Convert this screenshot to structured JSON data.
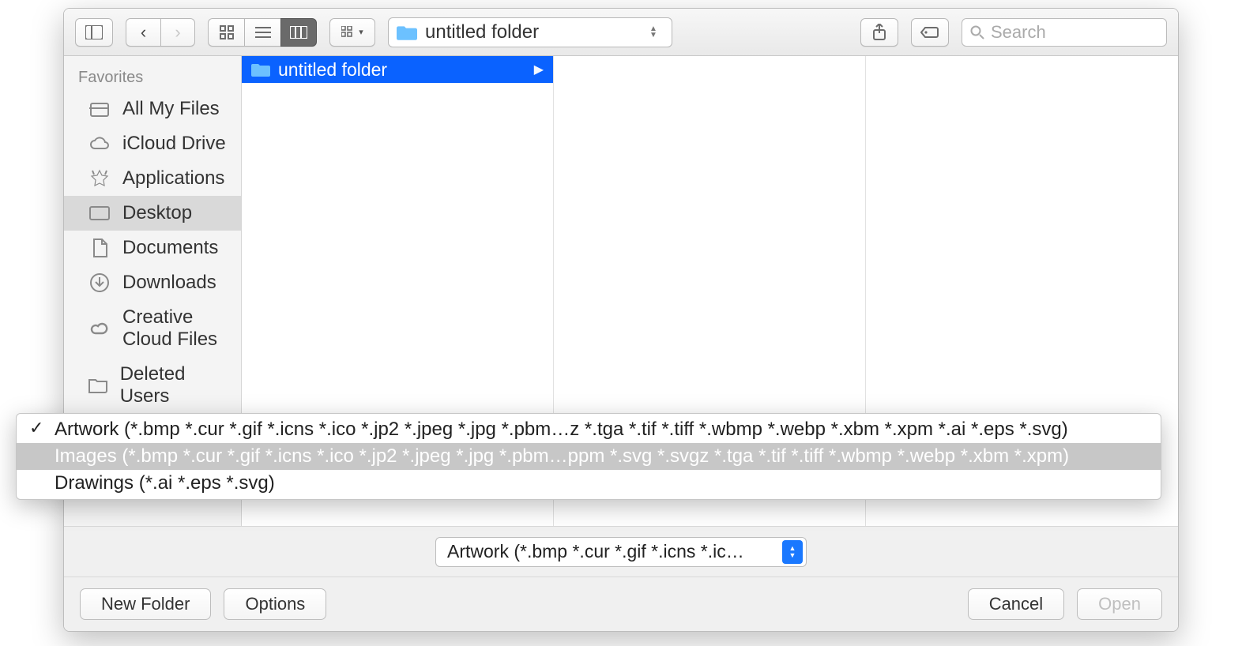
{
  "toolbar": {
    "path_label": "untitled folder",
    "search_placeholder": "Search"
  },
  "sidebar": {
    "header": "Favorites",
    "items": [
      {
        "label": "All My Files",
        "icon": "all-my-files-icon",
        "selected": false
      },
      {
        "label": "iCloud Drive",
        "icon": "icloud-icon",
        "selected": false
      },
      {
        "label": "Applications",
        "icon": "applications-icon",
        "selected": false
      },
      {
        "label": "Desktop",
        "icon": "desktop-icon",
        "selected": true
      },
      {
        "label": "Documents",
        "icon": "documents-icon",
        "selected": false
      },
      {
        "label": "Downloads",
        "icon": "downloads-icon",
        "selected": false
      },
      {
        "label": "Creative Cloud Files",
        "icon": "creative-cloud-icon",
        "selected": false
      },
      {
        "label": "Deleted Users",
        "icon": "folder-icon",
        "selected": false
      }
    ]
  },
  "columns": {
    "col0": [
      {
        "label": "untitled folder",
        "type": "folder",
        "selected": true
      }
    ]
  },
  "file_type": {
    "selected_label": "Artwork (*.bmp *.cur *.gif *.icns *.ic…",
    "options": [
      {
        "label": "Artwork (*.bmp *.cur *.gif *.icns *.ico *.jp2 *.jpeg *.jpg *.pbm…z *.tga *.tif *.tiff *.wbmp *.webp *.xbm *.xpm *.ai *.eps *.svg)",
        "checked": true,
        "highlighted": false
      },
      {
        "label": "Images (*.bmp *.cur *.gif *.icns *.ico *.jp2 *.jpeg *.jpg *.pbm…ppm *.svg *.svgz *.tga *.tif *.tiff *.wbmp *.webp *.xbm *.xpm)",
        "checked": false,
        "highlighted": true
      },
      {
        "label": "Drawings (*.ai *.eps *.svg)",
        "checked": false,
        "highlighted": false
      }
    ]
  },
  "footer": {
    "new_folder": "New Folder",
    "options": "Options",
    "cancel": "Cancel",
    "open": "Open"
  }
}
